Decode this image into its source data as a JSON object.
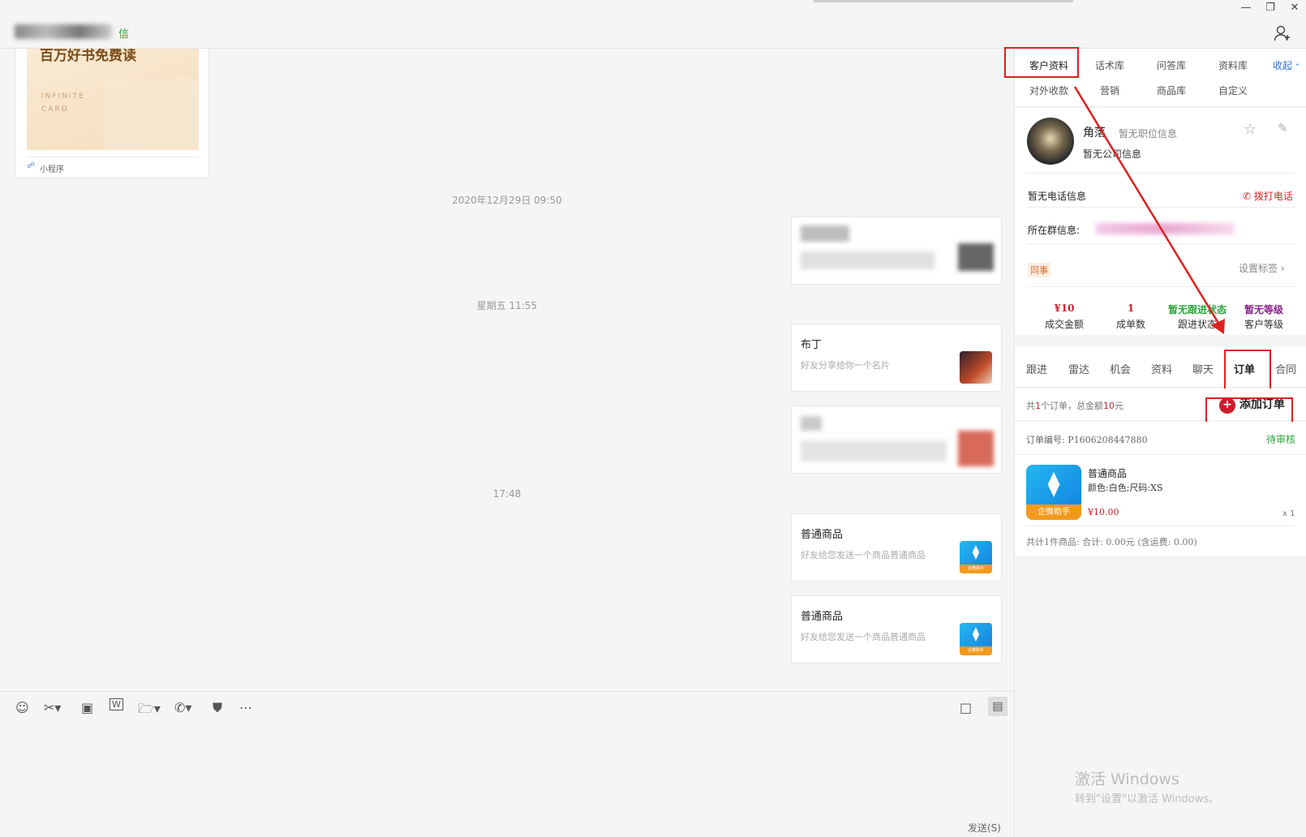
{
  "window": {
    "app_suffix": "信",
    "minimize": "—",
    "restore": "❐",
    "close": "✕",
    "add_contact_icon": "person-add-icon"
  },
  "chat": {
    "mini_card": {
      "title": "百万好书免费读",
      "line1": "INFINITE",
      "line2": "CARD",
      "footer": "小程序"
    },
    "times": [
      "2020年12月29日 09:50",
      "星期五 11:55",
      "17:48"
    ],
    "messages": [
      {
        "title": "布丁",
        "subtitle": "好友分享给你一个名片"
      },
      {
        "title": "普通商品",
        "subtitle": "好友给您发送一个商品普通商品"
      },
      {
        "title": "普通商品",
        "subtitle": "好友给您发送一个商品普通商品"
      }
    ],
    "app_icon_band": "企微助手",
    "send_label": "发送(S)"
  },
  "panel": {
    "tabs_row1": [
      "客户资料",
      "话术库",
      "问答库",
      "资料库"
    ],
    "collapse": "收起",
    "tabs_row2": [
      "对外收款",
      "营销",
      "商品库",
      "自定义"
    ],
    "customer": {
      "name": "角落",
      "position": "暂无职位信息",
      "company": "暂无公司信息",
      "phone": "暂无电话信息",
      "call": "拨打电话",
      "group_label": "所在群信息:",
      "tag": "同事",
      "set_tag": "设置标签"
    },
    "stats": [
      {
        "value": "¥10",
        "label": "成交金额",
        "color": "#c81e2c"
      },
      {
        "value": "1",
        "label": "成单数",
        "color": "#c81e2c"
      },
      {
        "value": "暂无跟进状态",
        "label": "跟进状态",
        "color": "#2aa53a"
      },
      {
        "value": "暂无等级",
        "label": "客户等级",
        "color": "#8a1f8a"
      }
    ],
    "subtabs": [
      "跟进",
      "雷达",
      "机会",
      "资料",
      "聊天",
      "订单",
      "合同"
    ],
    "orders_summary_a": "共",
    "orders_count": "1",
    "orders_summary_b": "个订单，总金额",
    "orders_total": "10",
    "orders_summary_c": "元",
    "add_order": "添加订单",
    "order": {
      "number": "订单编号: P1606208447880",
      "status": "待审核",
      "product": "普通商品",
      "spec": "颜色:白色;尺码:XS",
      "price": "¥10.00",
      "qty": "x 1",
      "summary": "共计1件商品: 合计: 0.00元 (含运费: 0.00)"
    },
    "watermark_title": "激活 Windows",
    "watermark_sub": "转到\"设置\"以激活 Windows。"
  },
  "colors": {
    "accent_blue": "#2f6fd6",
    "red": "#e02020",
    "green": "#2aa53a"
  }
}
